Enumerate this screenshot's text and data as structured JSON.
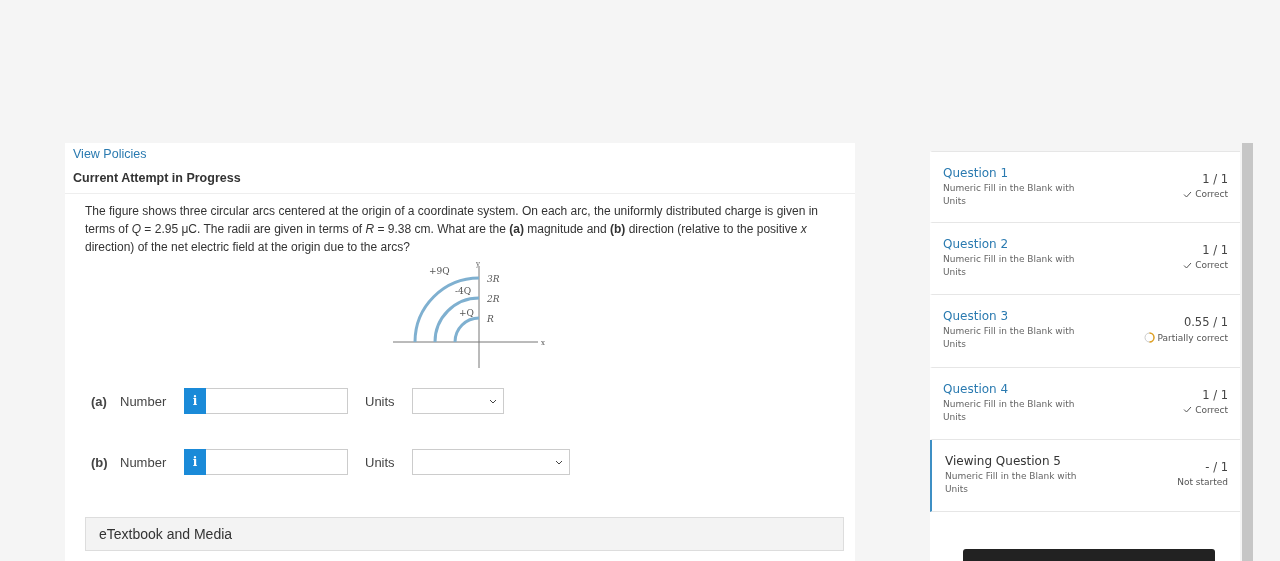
{
  "policies_link": "View Policies",
  "attempt_title": "Current Attempt in Progress",
  "question_text": "The figure shows three circular arcs centered at the origin of a coordinate system. On each arc, the uniformly distributed charge is given in terms of *Q* = 2.95 μC. The radii are given in terms of *R* = 9.38 cm. What are the **(a)** magnitude and **(b)** direction (relative to the positive *x* direction) of the net electric field at the origin due to the arcs?",
  "figure": {
    "axis_x": "x",
    "axis_y": "y",
    "arcs": [
      {
        "charge": "+9Q",
        "radius": "3R"
      },
      {
        "charge": "-4Q",
        "radius": "2R"
      },
      {
        "charge": "+Q",
        "radius": "R"
      }
    ]
  },
  "answers": [
    {
      "part": "(a)",
      "label": "Number",
      "units_label": "Units",
      "info": "i",
      "wide_units": false
    },
    {
      "part": "(b)",
      "label": "Number",
      "units_label": "Units",
      "info": "i",
      "wide_units": true
    }
  ],
  "etextbook": "eTextbook and Media",
  "questions": [
    {
      "title": "Question 1",
      "type": "Numeric Fill in the Blank with Units",
      "score": "1 / 1",
      "status": "Correct",
      "kind": "correct",
      "selected": false
    },
    {
      "title": "Question 2",
      "type": "Numeric Fill in the Blank with Units",
      "score": "1 / 1",
      "status": "Correct",
      "kind": "correct",
      "selected": false
    },
    {
      "title": "Question 3",
      "type": "Numeric Fill in the Blank with Units",
      "score": "0.55 / 1",
      "status": "Partially correct",
      "kind": "partial",
      "selected": false
    },
    {
      "title": "Question 4",
      "type": "Numeric Fill in the Blank with Units",
      "score": "1 / 1",
      "status": "Correct",
      "kind": "correct",
      "selected": false
    },
    {
      "title": "Viewing Question 5",
      "type": "Numeric Fill in the Blank with Units",
      "score": "- / 1",
      "status": "Not started",
      "kind": "not_started",
      "selected": true
    }
  ]
}
